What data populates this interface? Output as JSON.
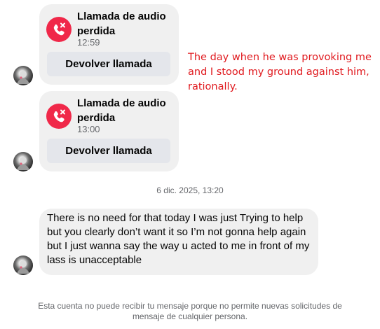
{
  "calls": [
    {
      "title": "Llamada de audio perdida",
      "time": "12:59",
      "button_label": "Devolver llamada",
      "icon": "missed-call-icon"
    },
    {
      "title": "Llamada de audio perdida",
      "time": "13:00",
      "button_label": "Devolver llamada",
      "icon": "missed-call-icon"
    }
  ],
  "annotation": "The day when he was provoking me and I stood my ground against him, rationally.",
  "timestamp": "6 dic. 2025, 13:20",
  "message": {
    "text": "There is no need for that today I was just Trying to help but you clearly don’t want it so I’m not gonna help again but I just wanna say the way u acted to me in front of my lass is unacceptable"
  },
  "notice": "Esta cuenta no puede recibir tu mensaje porque no permite nuevas solicitudes de mensaje de cualquier persona.",
  "colors": {
    "bubble": "#f0f0f0",
    "button": "#e4e6eb",
    "missed_call_red": "#f02849",
    "annotation_red": "#e0191e",
    "secondary_text": "#65676b"
  }
}
